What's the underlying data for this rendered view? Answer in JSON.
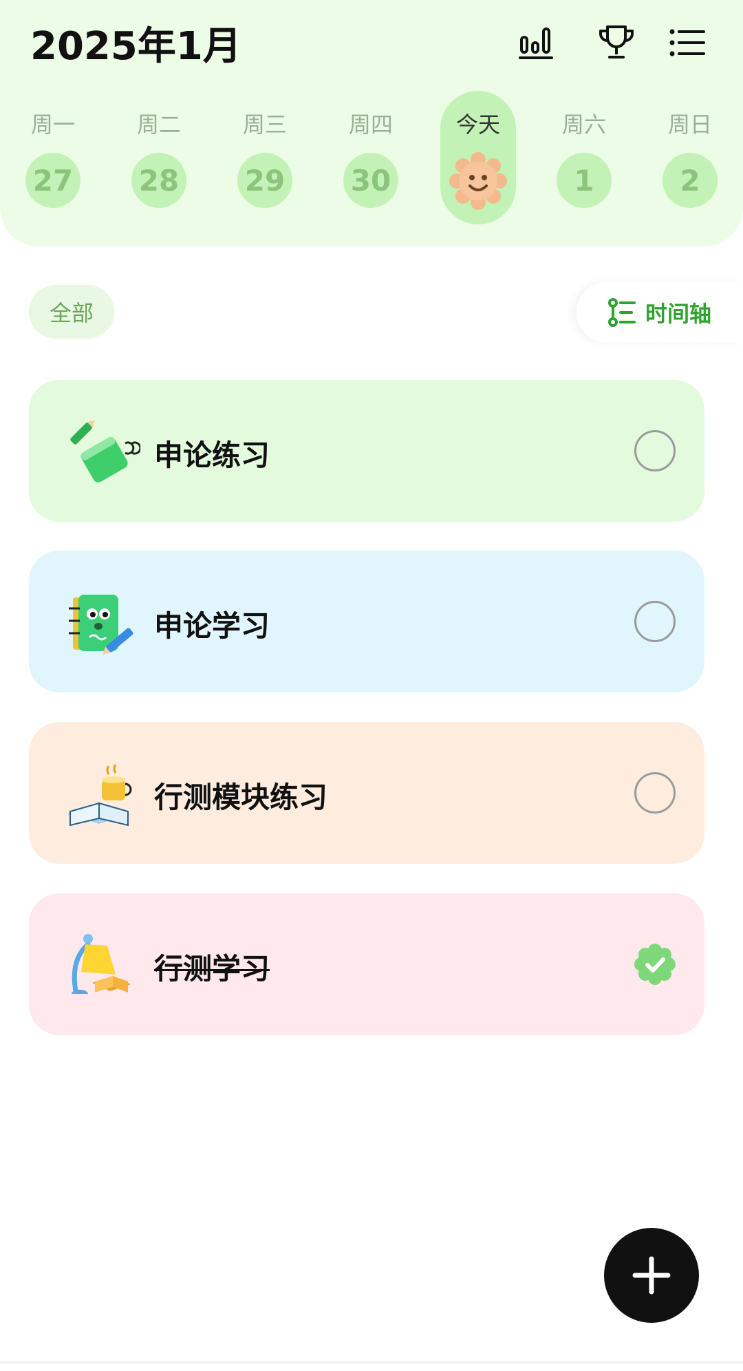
{
  "header": {
    "title": "2025年1月",
    "icons": [
      "stats-icon",
      "trophy-icon",
      "menu-icon"
    ]
  },
  "week": [
    {
      "label": "周一",
      "day": "27"
    },
    {
      "label": "周二",
      "day": "28"
    },
    {
      "label": "周三",
      "day": "29"
    },
    {
      "label": "周四",
      "day": "30"
    },
    {
      "label": "今天",
      "day": "",
      "today": true,
      "icon": "smiley-sun-icon"
    },
    {
      "label": "周六",
      "day": "1"
    },
    {
      "label": "周日",
      "day": "2"
    }
  ],
  "filter": {
    "label": "全部"
  },
  "timeline": {
    "label": "时间轴"
  },
  "tasks": [
    {
      "name": "申论练习",
      "done": false,
      "bg": "#e3fadd",
      "icon": "notebook-pencil-icon"
    },
    {
      "name": "申论学习",
      "done": false,
      "bg": "#e0f5fc",
      "icon": "notebook-character-icon"
    },
    {
      "name": "行测模块练习",
      "done": false,
      "bg": "#feeddf",
      "icon": "book-coffee-icon"
    },
    {
      "name": "行测学习",
      "done": true,
      "bg": "#ffe9ec",
      "icon": "lamp-book-icon"
    }
  ],
  "colors": {
    "accent": "#2ea32e",
    "header_bg": "#ecfce6",
    "day_circle": "#c2f2b5"
  }
}
